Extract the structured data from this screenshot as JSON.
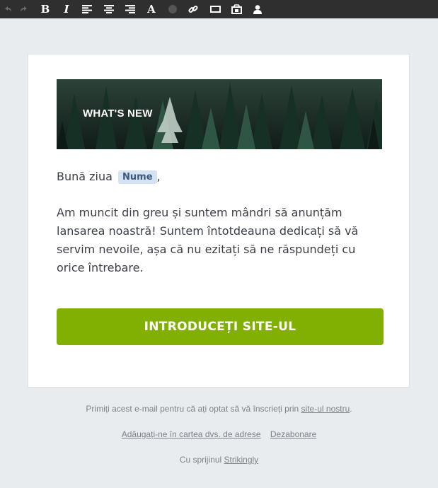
{
  "toolbar": {
    "tools": [
      {
        "icon": "undo-icon",
        "enabled": false
      },
      {
        "icon": "redo-icon",
        "enabled": false
      },
      {
        "icon": "bold-icon",
        "label": "B"
      },
      {
        "icon": "italic-icon",
        "label": "I"
      },
      {
        "icon": "align-left-icon"
      },
      {
        "icon": "align-center-icon"
      },
      {
        "icon": "align-right-icon"
      },
      {
        "icon": "font-icon",
        "label": "A"
      },
      {
        "icon": "color-dot-icon"
      },
      {
        "icon": "link-icon"
      },
      {
        "icon": "button-icon"
      },
      {
        "icon": "media-icon"
      },
      {
        "icon": "user-icon"
      }
    ]
  },
  "email": {
    "banner_title": "WHAT'S NEW",
    "greeting_prefix": "Bună ziua",
    "merge_tag": "Nume",
    "greeting_suffix": ",",
    "body_lines": [
      "Am muncit din greu și suntem mândri să anunțăm",
      "lansarea noastră! Suntem întotdeauna dedicați să vă",
      "servim nevoile, așa că nu ezitați să ne răspundeți cu",
      "orice întrebare."
    ],
    "cta_label": "INTRODUCEȚI SITE-UL"
  },
  "footer": {
    "optin_text": "Primiți acest e-mail pentru că ați optat să vă înscrieți prin",
    "optin_link": "site-ul nostru",
    "optin_end": ".",
    "address_book_link": "Adăugați-ne în cartea dvs. de adrese",
    "unsubscribe_link": "Dezabonare",
    "powered_prefix": "Cu sprijinul",
    "powered_link": "Strikingly"
  },
  "colors": {
    "toolbar_bg": "#2f2f2f",
    "page_bg": "#e9ecef",
    "cta_bg": "#81b002",
    "merge_tag_bg": "#d4e2f5"
  }
}
